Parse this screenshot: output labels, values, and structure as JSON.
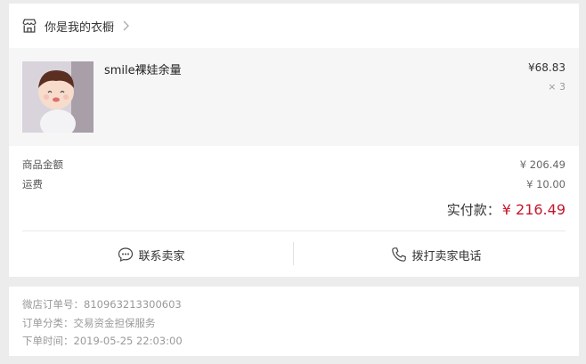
{
  "shop": {
    "name": "你是我的衣橱",
    "icon": "store-icon",
    "chevron_icon": "chevron-right-icon"
  },
  "product": {
    "title": "smile裸娃余量",
    "price": "¥68.83",
    "quantity": "× 3",
    "image": "doll-thumbnail"
  },
  "amounts": {
    "goods_label": "商品金额",
    "goods_value": "¥ 206.49",
    "shipping_label": "运费",
    "shipping_value": "¥ 10.00",
    "paid_label": "实付款：",
    "paid_value": "¥ 216.49"
  },
  "actions": {
    "contact_label": "联系卖家",
    "contact_icon": "chat-bubble-icon",
    "call_label": "拨打卖家电话",
    "call_icon": "phone-icon"
  },
  "order_info": {
    "order_no": "微店订单号：810963213300603",
    "category": "订单分类：交易资金担保服务",
    "time": "下单时间：2019-05-25 22:03:00"
  },
  "colors": {
    "accent_red": "#c4182d",
    "background": "#ececec"
  }
}
